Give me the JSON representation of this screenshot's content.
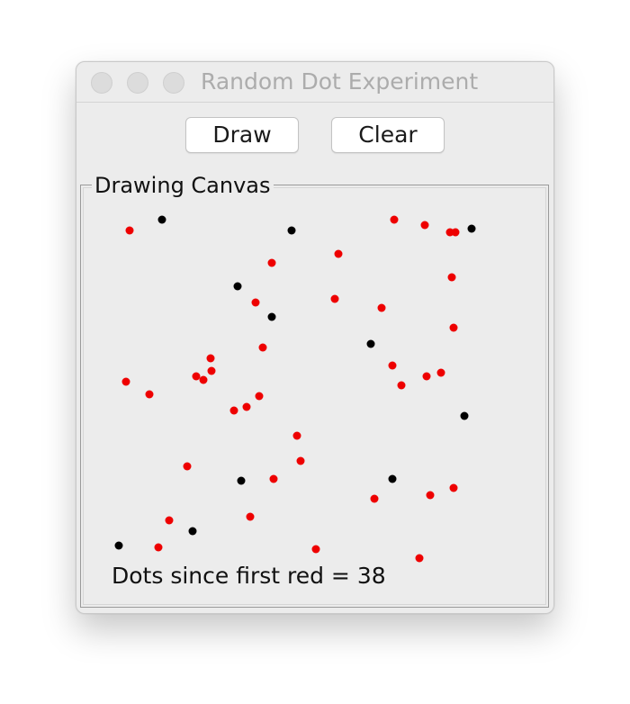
{
  "window": {
    "title": "Random Dot Experiment"
  },
  "toolbar": {
    "draw_label": "Draw",
    "clear_label": "Clear"
  },
  "canvas_panel": {
    "legend": "Drawing Canvas",
    "status_text": "Dots since first red = 38"
  },
  "colors": {
    "red_dot": "#ee0000",
    "black_dot": "#000000"
  }
}
